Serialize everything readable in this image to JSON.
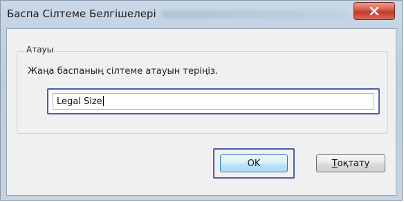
{
  "window": {
    "title": "Баспа Сілтеме Белгішелері"
  },
  "title_bar": {
    "close_icon": "close-x-icon"
  },
  "group": {
    "label": "Атауы"
  },
  "prompt_text": "Жаңа баспаның сілтеме атауын теріңіз.",
  "name_input": {
    "value": "Legal Size"
  },
  "buttons": {
    "ok_label": "OK",
    "cancel_underlined_letter": "Т",
    "cancel_rest": "оқтату"
  },
  "colors": {
    "close_button": "#c0392b",
    "focus_border": "#4a5fa8"
  }
}
